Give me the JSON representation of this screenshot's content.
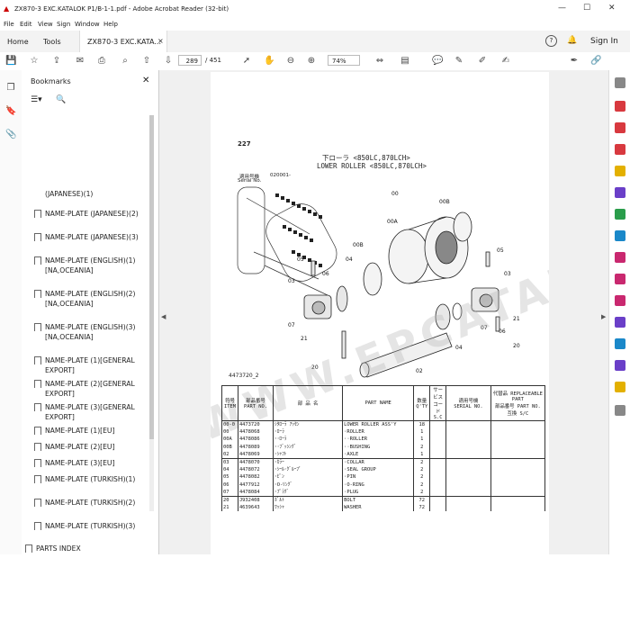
{
  "window": {
    "title": "ZX870-3 EXC.KATALOK P1/B-1-1.pdf - Adobe Acrobat Reader (32-bit)",
    "min": "—",
    "max": "☐",
    "close": "✕"
  },
  "menu": [
    "File",
    "Edit",
    "View",
    "Sign",
    "Window",
    "Help"
  ],
  "tabs": {
    "home": "Home",
    "tools": "Tools",
    "document": "ZX870-3 EXC.KATA...",
    "close": "×"
  },
  "account": {
    "help": "?",
    "sign_in": "Sign In"
  },
  "toolbar": {
    "page_current": "289",
    "page_total": "/ 451",
    "zoom": "74%"
  },
  "bookmarks": {
    "header": "Bookmarks",
    "close": "✕",
    "items": [
      "(JAPANESE)(1)",
      "NAME-PLATE (JAPANESE)(2)",
      "NAME-PLATE (JAPANESE)(3)",
      "NAME-PLATE (ENGLISH)(1)[NA,OCEANIA]",
      "NAME-PLATE (ENGLISH)(2)[NA,OCEANIA]",
      "NAME-PLATE (ENGLISH)(3)[NA,OCEANIA]",
      "NAME-PLATE (1)[GENERAL EXPORT]",
      "NAME-PLATE (2)[GENERAL EXPORT]",
      "NAME-PLATE (3)[GENERAL EXPORT]",
      "NAME-PLATE (1)[EU]",
      "NAME-PLATE (2)[EU]",
      "NAME-PLATE (3)[EU]",
      "NAME-PLATE (TURKISH)(1)",
      "NAME-PLATE (TURKISH)(2)",
      "NAME-PLATE (TURKISH)(3)",
      "PARTS INDEX"
    ]
  },
  "page": {
    "number": "227",
    "title_jp": "下ローラ <850LC,870LCH>",
    "title_en": "LOWER ROLLER <850LC,870LCH>",
    "serial_label_jp": "適用号機",
    "serial_label_en": "Serial No.",
    "serial_no": "020001-",
    "figure_no": "4473720_2",
    "callouts": [
      "00",
      "00A",
      "00B",
      "00B",
      "05",
      "06",
      "03",
      "07",
      "04",
      "21",
      "20",
      "02",
      "05",
      "03",
      "07",
      "06",
      "04",
      "21",
      "20"
    ],
    "watermark": "WWW.EPCATALOGS.COM",
    "table_header": {
      "no_jp": "符号",
      "no_en": "ITEM",
      "partno_jp": "部品番号",
      "partno_en": "PART NO.",
      "name_jp": "部 品 名",
      "name_en": "PART NAME",
      "qty_jp": "数量",
      "qty_en": "Q'TY",
      "code": "サービスコード S.C",
      "serial_jp": "適用号機",
      "serial_en": "SERIAL NO.",
      "rep_title": "代替品 REPLACEABLE PART",
      "rep_partno": "部品番号 PART NO.",
      "rep_sc": "互換 S/C"
    },
    "rows": [
      {
        "item": "00-0",
        "partno": "4473720",
        "jp": "ｼﾀﾛｰﾗ ｱｯｾﾝ",
        "name": "LOWER ROLLER ASS'Y",
        "qty": "18"
      },
      {
        "item": "00",
        "partno": "4478068",
        "jp": "･ﾛｰﾗ",
        "name": "·ROLLER",
        "qty": "1"
      },
      {
        "item": "00A",
        "partno": "4478086",
        "jp": "･･ﾛｰﾗ",
        "name": "··ROLLER",
        "qty": "1"
      },
      {
        "item": "00B",
        "partno": "4478089",
        "jp": "･･ﾌﾞｯｼﾝｸﾞ",
        "name": "··BUSHING",
        "qty": "2"
      },
      {
        "item": "02",
        "partno": "4478069",
        "jp": "･ｼｬﾌﾄ",
        "name": "·AXLE",
        "qty": "1"
      },
      {
        "item": "03",
        "partno": "4478070",
        "jp": "･ｶﾗｰ",
        "name": "·COLLAR",
        "qty": "2"
      },
      {
        "item": "04",
        "partno": "4478072",
        "jp": "･ｼｰﾙ･ｸﾞﾙｰﾌﾟ",
        "name": "·SEAL GROUP",
        "qty": "2"
      },
      {
        "item": "05",
        "partno": "4478082",
        "jp": "･ﾋﾟﾝ",
        "name": "·PIN",
        "qty": "2"
      },
      {
        "item": "06",
        "partno": "4477912",
        "jp": "･O-ﾘﾝｸﾞ",
        "name": "·O-RING",
        "qty": "2"
      },
      {
        "item": "07",
        "partno": "4478084",
        "jp": "･ﾌﾟﾗｸﾞ",
        "name": "·PLUG",
        "qty": "2"
      },
      {
        "item": "20",
        "partno": "J932408",
        "jp": "ﾎﾞﾙﾄ",
        "name": "BOLT",
        "qty": "72"
      },
      {
        "item": "21",
        "partno": "4639643",
        "jp": "ﾜｯｼｬ",
        "name": "WASHER",
        "qty": "72"
      }
    ]
  }
}
